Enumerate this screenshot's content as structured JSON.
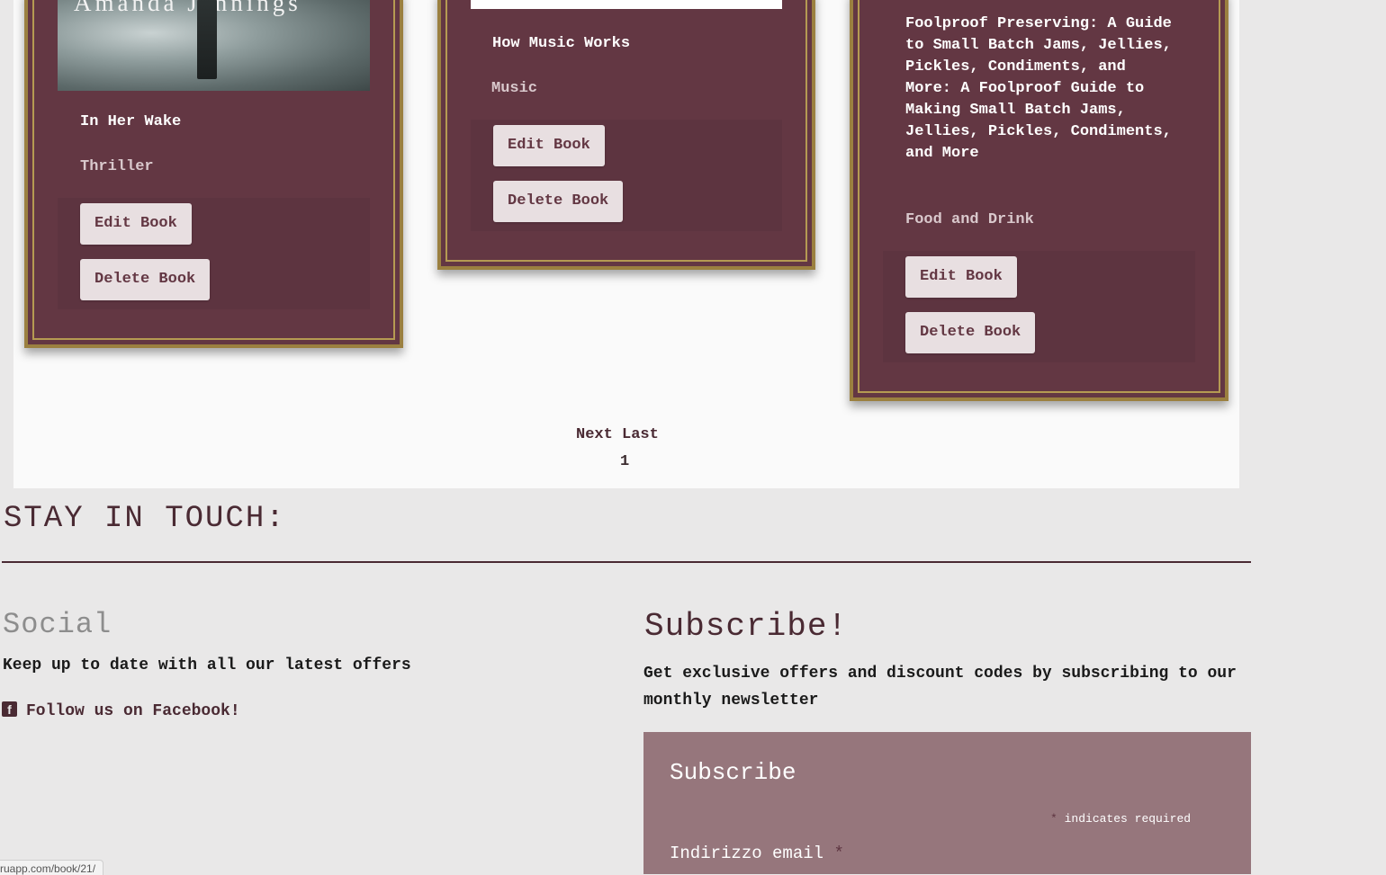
{
  "books": [
    {
      "cover_author": "Amanda Jennings",
      "title": "In Her Wake",
      "genre": "Thriller",
      "edit_label": "Edit Book",
      "delete_label": "Delete Book"
    },
    {
      "title": "How Music Works",
      "genre": "Music",
      "edit_label": "Edit Book",
      "delete_label": "Delete Book"
    },
    {
      "title": "Foolproof Preserving: A Guide to Small Batch Jams, Jellies, Pickles, Condiments, and More: A Foolproof Guide to Making Small Batch Jams, Jellies, Pickles, Condiments, and More",
      "genre": "Food and Drink",
      "edit_label": "Edit Book",
      "delete_label": "Delete Book"
    }
  ],
  "pagination": {
    "next": "Next",
    "last": "Last",
    "current_page": "1"
  },
  "footer": {
    "heading": "STAY IN TOUCH:",
    "social": {
      "title": "Social",
      "text": "Keep up to date with all our latest offers",
      "facebook_link": "Follow us on Facebook!",
      "icon": "facebook-icon"
    },
    "subscribe": {
      "title": "Subscribe!",
      "text": "Get exclusive offers and discount codes by subscribing to our monthly newsletter",
      "form_title": "Subscribe",
      "asterisk": "*",
      "required_note": "indicates required",
      "email_label": "Indirizzo email"
    }
  },
  "status_bar": {
    "url": "ruapp.com/book/21/"
  },
  "colors": {
    "card_bg": "#633743",
    "card_border": "#9b8040",
    "button_bg": "#e8dfe1",
    "accent_text": "#4a2a33",
    "subscribe_box": "#96767c"
  }
}
